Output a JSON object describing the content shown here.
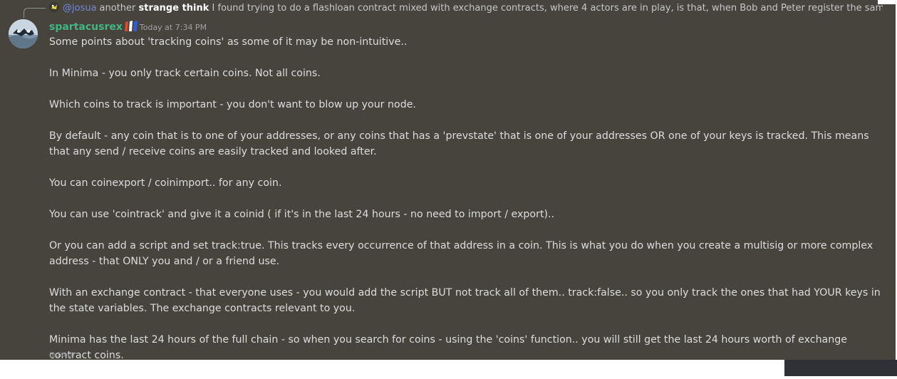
{
  "reply": {
    "mention": "@josua",
    "text_before": "another ",
    "text_bold": "strange think",
    "text_after": " I found trying to do a flashloan contract mixed with exchange contracts, where 4 actors are in play, is that, when Bob and Peter register the same exchange contract , ..."
  },
  "message": {
    "author": "spartacusrex",
    "timestamp": "Today at 7:34 PM",
    "paragraphs": [
      "Some points about 'tracking coins' as some of it may be non-intuitive..",
      "In Minima - you only track certain coins. Not all coins.",
      "Which coins to track is important - you don't want to blow up your node.",
      "By default - any coin that is to one of your addresses, or any coins that has a 'prevstate'  that is one of your addresses OR one of your keys is tracked. This means that any send / receive coins are easily tracked and looked after.",
      "You can coinexport / coinimport..  for any coin.",
      "You can use  'cointrack' and give it a coinid ( if it's in the last 24 hours - no need to import / export)..",
      "Or you can add a script and set track:true. This tracks every occurrence of that address in a coin. This is what you do when you create a multisig or more complex address - that ONLY you and / or a friend use.",
      "With an exchange contract - that everyone uses - you would add the script BUT not track all of them.. track:false.. so you only track the ones that had YOUR keys in the state variables. The exchange contracts relevant to you.",
      "Minima has the last 24 hours of the full chain - so when you search for coins - using the 'coins' function.. you will still get the last 24 hours worth of exchange contract coins."
    ],
    "edited_label": "(edited)"
  },
  "colors": {
    "background": "#47443e",
    "author": "#43b581",
    "mention": "#7289da",
    "text": "#dcddde"
  },
  "icons": {
    "reply_avatar": "reply-avatar-icon",
    "author_avatar": "avatar-icon",
    "badge": "flag-badge-icon"
  }
}
